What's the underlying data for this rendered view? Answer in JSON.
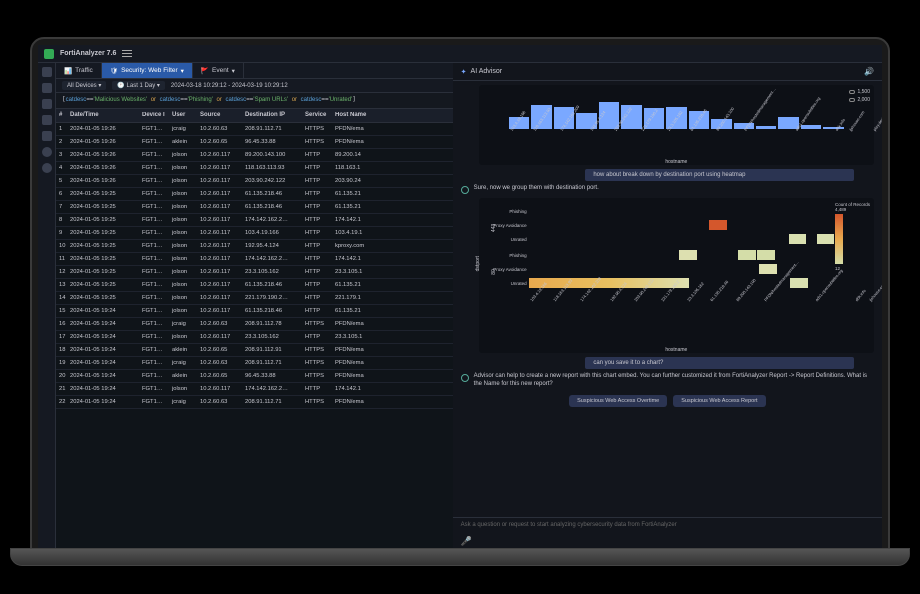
{
  "app": {
    "title": "FortiAnalyzer 7.6"
  },
  "tabs": [
    {
      "icon": "chart",
      "label": "Traffic"
    },
    {
      "icon": "shield",
      "label": "Security: Web Filter"
    },
    {
      "icon": "flag",
      "label": "Event"
    }
  ],
  "filters": {
    "devices": "All Devices",
    "period": "Last 1 Day",
    "range": "2024-03-18 10:29:12 - 2024-03-19 10:29:12"
  },
  "query": {
    "parts": [
      {
        "f": "catdesc",
        "v": "'Malicious Websites'"
      },
      {
        "or": "or"
      },
      {
        "f": "catdesc",
        "v": "'Phishing'"
      },
      {
        "or": "or"
      },
      {
        "f": "catdesc",
        "v": "'Spam URLs'"
      },
      {
        "or": "or"
      },
      {
        "f": "catdesc",
        "v": "'Unrated'"
      }
    ]
  },
  "cols": [
    "#",
    "Date/Time",
    "Device I",
    "User",
    "Source",
    "Destination IP",
    "Service",
    "Host Name"
  ],
  "rows": [
    {
      "n": "1",
      "dt": "2024-01-05 19:26",
      "dev": "FGT1…",
      "usr": "jcraig",
      "src": "10.2.60.63",
      "dst": "208.91.112.71",
      "svc": "HTTPS",
      "hn": "PFDN/ema"
    },
    {
      "n": "2",
      "dt": "2024-01-05 19:26",
      "dev": "FGT1…",
      "usr": "aklein",
      "src": "10.2.60.65",
      "dst": "96.45.33.88",
      "svc": "HTTPS",
      "hn": "PFDN/ema"
    },
    {
      "n": "3",
      "dt": "2024-01-05 19:26",
      "dev": "FGT1…",
      "usr": "jolson",
      "src": "10.2.60.117",
      "dst": "89.200.143.100",
      "svc": "HTTP",
      "hn": "89.200.14"
    },
    {
      "n": "4",
      "dt": "2024-01-05 19:26",
      "dev": "FGT1…",
      "usr": "jolson",
      "src": "10.2.60.117",
      "dst": "118.163.113.93",
      "svc": "HTTP",
      "hn": "118.163.1"
    },
    {
      "n": "5",
      "dt": "2024-01-05 19:26",
      "dev": "FGT1…",
      "usr": "jolson",
      "src": "10.2.60.117",
      "dst": "203.90.242.122",
      "svc": "HTTP",
      "hn": "203.90.24"
    },
    {
      "n": "6",
      "dt": "2024-01-05 19:25",
      "dev": "FGT1…",
      "usr": "jolson",
      "src": "10.2.60.117",
      "dst": "61.135.218.46",
      "svc": "HTTP",
      "hn": "61.135.21"
    },
    {
      "n": "7",
      "dt": "2024-01-05 19:25",
      "dev": "FGT1…",
      "usr": "jolson",
      "src": "10.2.60.117",
      "dst": "61.135.218.46",
      "svc": "HTTP",
      "hn": "61.135.21"
    },
    {
      "n": "8",
      "dt": "2024-01-05 19:25",
      "dev": "FGT1…",
      "usr": "jolson",
      "src": "10.2.60.117",
      "dst": "174.142.162.2…",
      "svc": "HTTP",
      "hn": "174.142.1"
    },
    {
      "n": "9",
      "dt": "2024-01-05 19:25",
      "dev": "FGT1…",
      "usr": "jolson",
      "src": "10.2.60.117",
      "dst": "103.4.19.166",
      "svc": "HTTP",
      "hn": "103.4.19.1"
    },
    {
      "n": "10",
      "dt": "2024-01-05 19:25",
      "dev": "FGT1…",
      "usr": "jolson",
      "src": "10.2.60.117",
      "dst": "192.95.4.124",
      "svc": "HTTP",
      "hn": "kproxy.com"
    },
    {
      "n": "11",
      "dt": "2024-01-05 19:25",
      "dev": "FGT1…",
      "usr": "jolson",
      "src": "10.2.60.117",
      "dst": "174.142.162.2…",
      "svc": "HTTP",
      "hn": "174.142.1"
    },
    {
      "n": "12",
      "dt": "2024-01-05 19:25",
      "dev": "FGT1…",
      "usr": "jolson",
      "src": "10.2.60.117",
      "dst": "23.3.105.162",
      "svc": "HTTP",
      "hn": "23.3.105.1"
    },
    {
      "n": "13",
      "dt": "2024-01-05 19:25",
      "dev": "FGT1…",
      "usr": "jolson",
      "src": "10.2.60.117",
      "dst": "61.135.218.46",
      "svc": "HTTP",
      "hn": "61.135.21"
    },
    {
      "n": "14",
      "dt": "2024-01-05 19:25",
      "dev": "FGT1…",
      "usr": "jolson",
      "src": "10.2.60.117",
      "dst": "221.179.190.2…",
      "svc": "HTTP",
      "hn": "221.179.1"
    },
    {
      "n": "15",
      "dt": "2024-01-05 19:24",
      "dev": "FGT1…",
      "usr": "jolson",
      "src": "10.2.60.117",
      "dst": "61.135.218.46",
      "svc": "HTTP",
      "hn": "61.135.21"
    },
    {
      "n": "16",
      "dt": "2024-01-05 19:24",
      "dev": "FGT1…",
      "usr": "jcraig",
      "src": "10.2.60.63",
      "dst": "208.91.112.78",
      "svc": "HTTPS",
      "hn": "PFDN/ema"
    },
    {
      "n": "17",
      "dt": "2024-01-05 19:24",
      "dev": "FGT1…",
      "usr": "jolson",
      "src": "10.2.60.117",
      "dst": "23.3.105.162",
      "svc": "HTTP",
      "hn": "23.3.105.1"
    },
    {
      "n": "18",
      "dt": "2024-01-05 19:24",
      "dev": "FGT1…",
      "usr": "aklein",
      "src": "10.2.60.65",
      "dst": "208.91.112.91",
      "svc": "HTTPS",
      "hn": "PFDN/ema"
    },
    {
      "n": "19",
      "dt": "2024-01-05 19:24",
      "dev": "FGT1…",
      "usr": "jcraig",
      "src": "10.2.60.63",
      "dst": "208.91.112.71",
      "svc": "HTTPS",
      "hn": "PFDN/ema"
    },
    {
      "n": "20",
      "dt": "2024-01-05 19:24",
      "dev": "FGT1…",
      "usr": "aklein",
      "src": "10.2.60.65",
      "dst": "96.45.33.88",
      "svc": "HTTPS",
      "hn": "PFDN/ema"
    },
    {
      "n": "21",
      "dt": "2024-01-05 19:24",
      "dev": "FGT1…",
      "usr": "jolson",
      "src": "10.2.60.117",
      "dst": "174.142.162.2…",
      "svc": "HTTP",
      "hn": "174.142.1"
    },
    {
      "n": "22",
      "dt": "2024-01-05 19:24",
      "dev": "FGT1…",
      "usr": "jcraig",
      "src": "10.2.60.63",
      "dst": "208.91.112.71",
      "svc": "HTTPS",
      "hn": "PFDN/ema"
    }
  ],
  "ai": {
    "header": "AI Advisor",
    "chart1_legend": [
      "1,500",
      "2,000"
    ],
    "chart1_xaxis": "hostname",
    "user_msg1": "how about break down by destination port using heatmap",
    "reply1": "Sure, now we group them with destination port.",
    "heatmap_ylabel": "dstport",
    "heatmap_xaxis": "hostname",
    "heatmap_sections": [
      "443",
      "80"
    ],
    "heatmap_cats": [
      "Phishing",
      "Proxy Avoidance",
      "Unrated"
    ],
    "heatmap_legend_title": "Count of Records",
    "heatmap_legend_max": "4,489",
    "heatmap_legend_min": "12",
    "user_msg2": "can you save it to a chart?",
    "reply2": "Advisor can help to create a new report with this chart embed. You can further customized it from FortiAnalyzer Report -> Report Definitions. What is the Name for this new report?",
    "buttons": [
      "Suspicious Web Access Overtime",
      "Suspicious Web Access Report"
    ],
    "input_placeholder": "Ask a question or request to start analyzing cybersecurity data from FortiAnalyzer"
  },
  "chart_data": [
    {
      "type": "bar",
      "title": "",
      "xlabel": "hostname",
      "ylabel": "",
      "categories": [
        "103.4.19.166",
        "118.163.113.93",
        "174.142.162.209",
        "192.95.4.124",
        "203.90.242.122",
        "221.179.190.2",
        "23.3.105.162",
        "61.135.218.46",
        "89.200.143.100",
        "PFDN/hostedmanagement…",
        "ads1.opensubtitles.org",
        "d5k.info",
        "jjshouse.com",
        "play.devtest.net",
        "sbt3.opensubtitles…"
      ],
      "series": [
        {
          "name": "1,500",
          "values": [
            30,
            60,
            55,
            40,
            68,
            60,
            52,
            55,
            45,
            25,
            15,
            8,
            30,
            10,
            5
          ]
        },
        {
          "name": "2,000",
          "values": [
            25,
            55,
            48,
            35,
            60,
            55,
            45,
            50,
            40,
            20,
            12,
            6,
            25,
            8,
            4
          ]
        }
      ]
    },
    {
      "type": "heatmap",
      "xlabel": "hostname",
      "ylabel": "dstport",
      "x": [
        "103.4.19.166",
        "118.163.113.93",
        "174.142.162.209",
        "192.95.4.124",
        "203.90.242.122",
        "221.179.190.2",
        "23.3.105.162",
        "61.135.218.46",
        "89.200.143.100",
        "PFDN/hostedmanagement…",
        "ads1.opensubtitles.org",
        "d5k.info",
        "jjshouse.com",
        "play.devtest.net",
        "sbt3.opensubtitles…"
      ],
      "y_groups": [
        {
          "port": "443",
          "rows": [
            "Phishing",
            "Proxy Avoidance",
            "Unrated"
          ]
        },
        {
          "port": "80",
          "rows": [
            "Phishing",
            "Proxy Avoidance",
            "Unrated"
          ]
        }
      ],
      "color_scale": {
        "min": 12,
        "max": 4489
      }
    }
  ]
}
